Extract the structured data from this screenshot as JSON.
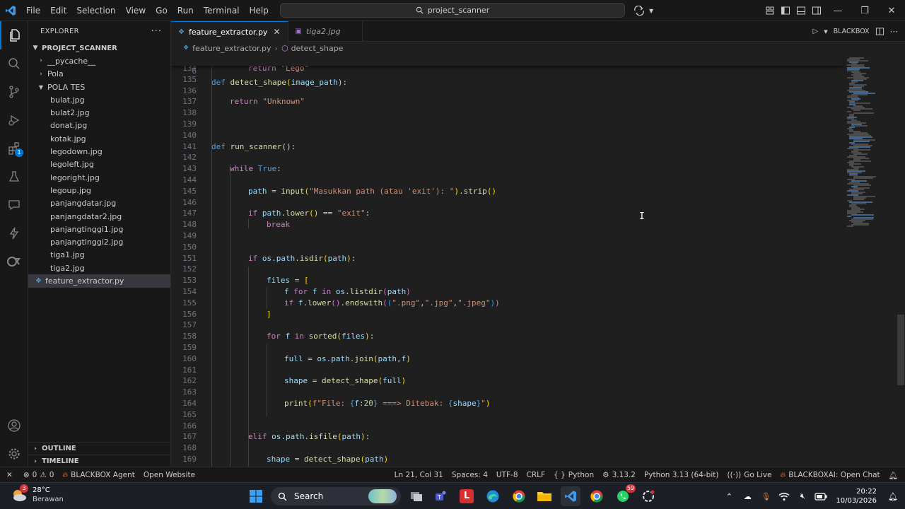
{
  "menu": [
    "File",
    "Edit",
    "Selection",
    "View",
    "Go",
    "Run",
    "Terminal",
    "Help"
  ],
  "search": {
    "text": "project_scanner"
  },
  "sidebar": {
    "title": "EXPLORER",
    "project": "PROJECT_SCANNER",
    "folders": [
      "__pycache__",
      "Pola",
      "POLA TES"
    ],
    "files": [
      "bulat.jpg",
      "bulat2.jpg",
      "donat.jpg",
      "kotak.jpg",
      "legodown.jpg",
      "legoleft.jpg",
      "legoright.jpg",
      "legoup.jpg",
      "panjangdatar.jpg",
      "panjangdatar2.jpg",
      "panjangtinggi1.jpg",
      "panjangtinggi2.jpg",
      "tiga1.jpg",
      "tiga2.jpg"
    ],
    "active_file": "feature_extractor.py",
    "outline": "OUTLINE",
    "timeline": "TIMELINE",
    "badge": "1"
  },
  "tabs": [
    {
      "label": "feature_extractor.py"
    },
    {
      "label": "tiga2.jpg"
    }
  ],
  "tabs_right": {
    "blackbox": "BLACKBOX"
  },
  "breadcrumb": {
    "file": "feature_extractor.py",
    "symbol": "detect_shape"
  },
  "editor": {
    "sticky": {
      "ln": "6",
      "kw": "def",
      "fn": "detect_shape",
      "param": "image_path",
      "end": "):"
    },
    "lines": [
      {
        "ln": "134",
        "text": ""
      },
      {
        "ln": "135",
        "text": ""
      },
      {
        "ln": "136",
        "text": ""
      },
      {
        "ln": "137",
        "text": ""
      },
      {
        "ln": "138",
        "text": ""
      },
      {
        "ln": "139",
        "text": ""
      },
      {
        "ln": "140",
        "text": ""
      },
      {
        "ln": "141",
        "text": ""
      },
      {
        "ln": "142",
        "text": ""
      },
      {
        "ln": "143",
        "text": ""
      },
      {
        "ln": "144",
        "text": ""
      },
      {
        "ln": "145",
        "text": ""
      },
      {
        "ln": "146",
        "text": ""
      },
      {
        "ln": "147",
        "text": ""
      },
      {
        "ln": "148",
        "text": ""
      },
      {
        "ln": "149",
        "text": ""
      },
      {
        "ln": "150",
        "text": ""
      },
      {
        "ln": "151",
        "text": ""
      },
      {
        "ln": "152",
        "text": ""
      },
      {
        "ln": "153",
        "text": ""
      },
      {
        "ln": "154",
        "text": ""
      },
      {
        "ln": "155",
        "text": ""
      },
      {
        "ln": "156",
        "text": ""
      },
      {
        "ln": "157",
        "text": ""
      },
      {
        "ln": "158",
        "text": ""
      },
      {
        "ln": "159",
        "text": ""
      },
      {
        "ln": "160",
        "text": ""
      },
      {
        "ln": "161",
        "text": ""
      },
      {
        "ln": "162",
        "text": ""
      },
      {
        "ln": "163",
        "text": ""
      },
      {
        "ln": "164",
        "text": ""
      },
      {
        "ln": "165",
        "text": ""
      },
      {
        "ln": "166",
        "text": ""
      },
      {
        "ln": "167",
        "text": ""
      },
      {
        "ln": "168",
        "text": ""
      },
      {
        "ln": "169",
        "text": ""
      }
    ],
    "tokens": {
      "return": "return",
      "lego": "\"Lego\"",
      "unknown": "\"Unknown\"",
      "def": "def",
      "run_scanner": "run_scanner",
      "paren_colon": "():",
      "while": "while",
      "true": "True",
      "colon": ":",
      "path": "path",
      "eq": " = ",
      "input": "input",
      "prompt": "\"Masukkan path (atau 'exit'): \"",
      "strip": ".strip",
      "if": "if",
      "lower": ".lower",
      "eqeq": " == ",
      "exit": "\"exit\"",
      "break": "break",
      "os": "os",
      "dot_path": ".path",
      "isdir": ".isdir",
      "files": "files",
      "lbrack": "[",
      "rbrack": "]",
      "f": "f",
      "for": "for",
      "in": "in",
      "listdir": ".listdir",
      "endswith": ".endswith",
      "png": "\".png\"",
      "jpg": "\".jpg\"",
      "jpeg": "\".jpeg\"",
      "comma": ",",
      "sorted": "sorted",
      "full": "full",
      "join": ".join",
      "shape": "shape",
      "detect_shape": "detect_shape",
      "print": "print",
      "fstr_a": "f\"File: ",
      "fmt": ":20",
      "fstr_b": " ===> Ditebak: ",
      "fstr_c": "\"",
      "elif": "elif",
      "isfile": ".isfile"
    }
  },
  "status": {
    "errors": "0",
    "warnings": "0",
    "agent": "BLACKBOX Agent",
    "open_website": "Open Website",
    "cursor": "Ln 21, Col 31",
    "spaces": "Spaces: 4",
    "encoding": "UTF-8",
    "eol": "CRLF",
    "language": "Python",
    "py_version": "3.13.2",
    "interpreter": "Python 3.13 (64-bit)",
    "golive": "Go Live",
    "blackboxai": "BLACKBOXAI: Open Chat"
  },
  "taskbar": {
    "temp": "28°C",
    "weather": "Berawan",
    "search": "Search",
    "weather_badge": "3",
    "time": "20:22",
    "date": "10/03/2026",
    "whatsapp_badge": "59"
  },
  "colors": {
    "accent": "#0078d4",
    "background": "#1f1f1f",
    "sidebar": "#181818"
  }
}
